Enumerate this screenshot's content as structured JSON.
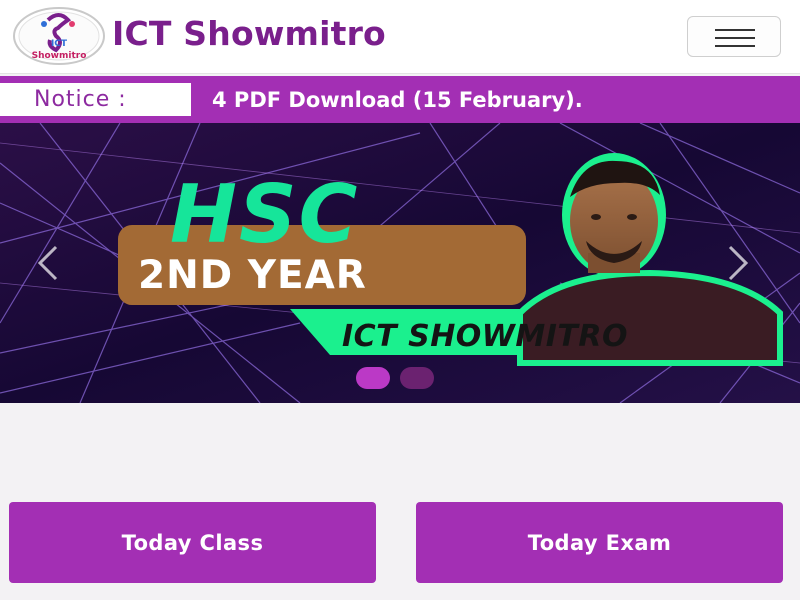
{
  "header": {
    "brand": "ICT Showmitro",
    "logo_text_top": "ICT",
    "logo_text_bottom": "Showmitro",
    "menu_icon": "hamburger-menu-icon"
  },
  "notice": {
    "label": "Notice :",
    "message": "4 PDF Download (15 February)."
  },
  "carousel": {
    "slide_title": "HSC",
    "slide_subtitle": "2ND YEAR",
    "slide_ribbon": "ICT SHOWMITRO",
    "prev_icon": "chevron-left-icon",
    "next_icon": "chevron-right-icon",
    "active_slide": 1,
    "slide_count": 2
  },
  "actions": {
    "today_class": "Today Class",
    "today_exam": "Today Exam"
  },
  "colors": {
    "brand_purple": "#7a1f8c",
    "bar_purple": "#a32fb4",
    "accent_green": "#16e59a",
    "banner_bg": "#1a0b35",
    "label_box": "#a36a35"
  }
}
